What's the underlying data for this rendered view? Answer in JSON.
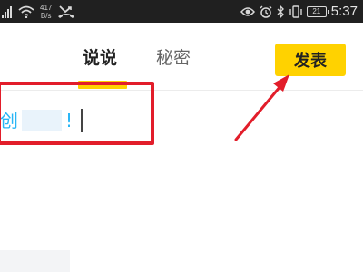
{
  "status_bar": {
    "net_speed_value": "417",
    "net_speed_unit": "B/s",
    "battery": "21",
    "time": "5:37",
    "icons": [
      "signal-icon",
      "wifi-icon",
      "missed-call-icon",
      "eye-icon",
      "alarm-icon",
      "bluetooth-icon",
      "vibrate-icon",
      "battery-icon"
    ]
  },
  "header": {
    "tabs": [
      {
        "label": "说说",
        "active": true
      },
      {
        "label": "秘密",
        "active": false
      }
    ],
    "publish_label": "发表"
  },
  "editor": {
    "visible_text_start": "创",
    "visible_text_end": "!"
  },
  "colors": {
    "accent": "#ffd200",
    "highlight": "#e21d2a",
    "text_link": "#29b6f6",
    "status_bar_bg": "#202020"
  }
}
